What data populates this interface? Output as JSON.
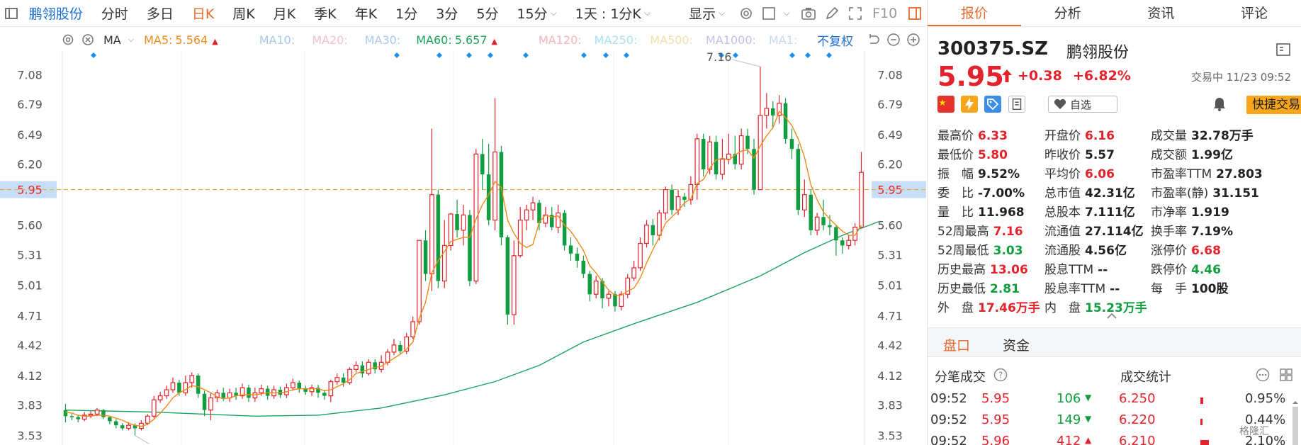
{
  "toolbar": {
    "stock_name": "鹏翎股份",
    "periods": [
      "分时",
      "多日",
      "日K",
      "周K",
      "月K",
      "季K",
      "年K",
      "1分",
      "3分",
      "5分",
      "15分"
    ],
    "active_period": "日K",
    "range_label": "1天 : 1分K",
    "display_label": "显示",
    "f10_label": "F10"
  },
  "ma_bar": {
    "indicator": "MA",
    "ma5": {
      "label": "MA5:",
      "value": "5.564",
      "color": "#ee8a1b"
    },
    "ma10": {
      "label": "MA10:",
      "color": "#a8c7ee"
    },
    "ma20": {
      "label": "MA20:",
      "color": "#f3c0d2"
    },
    "ma30": {
      "label": "MA30:",
      "color": "#a8c7ee"
    },
    "ma60": {
      "label": "MA60:",
      "value": "5.657",
      "color": "#19a35a"
    },
    "ma120": {
      "label": "MA120:",
      "color": "#f3b3bf"
    },
    "ma250": {
      "label": "MA250:",
      "color": "#a9e0f2"
    },
    "ma500": {
      "label": "MA500:",
      "color": "#f2e0a9"
    },
    "ma1000": {
      "label": "MA1000:",
      "color": "#c6bde6"
    },
    "ma1": {
      "label": "MA1:",
      "color": "#c9d8ee"
    },
    "adjust_label": "不复权"
  },
  "chart_data": {
    "type": "candlestick",
    "y_ticks": [
      "7.08",
      "6.79",
      "6.49",
      "6.20",
      "5.95",
      "5.60",
      "5.31",
      "5.01",
      "4.71",
      "4.42",
      "4.12",
      "3.83",
      "3.53"
    ],
    "ylim": [
      3.45,
      7.3
    ],
    "current_price": 5.95,
    "annotations": {
      "high": "7.16",
      "low": "3.53"
    },
    "colors": {
      "up": "#e4222b",
      "down": "#0f9d3f",
      "ma5": "#ee8a1b",
      "ma60": "#19a35a",
      "price_line": "#f2a33a",
      "marker": "#1e8fe8"
    },
    "candles": [
      [
        3.78,
        3.72,
        3.84,
        3.66
      ],
      [
        3.72,
        3.71,
        3.74,
        3.68
      ],
      [
        3.71,
        3.69,
        3.73,
        3.66
      ],
      [
        3.69,
        3.73,
        3.76,
        3.67
      ],
      [
        3.73,
        3.74,
        3.77,
        3.7
      ],
      [
        3.74,
        3.78,
        3.8,
        3.72
      ],
      [
        3.78,
        3.71,
        3.79,
        3.69
      ],
      [
        3.71,
        3.67,
        3.72,
        3.64
      ],
      [
        3.67,
        3.63,
        3.69,
        3.6
      ],
      [
        3.63,
        3.6,
        3.65,
        3.58
      ],
      [
        3.6,
        3.63,
        3.66,
        3.58
      ],
      [
        3.63,
        3.6,
        3.65,
        3.53
      ],
      [
        3.6,
        3.65,
        3.68,
        3.58
      ],
      [
        3.65,
        3.72,
        3.74,
        3.63
      ],
      [
        3.72,
        3.88,
        3.92,
        3.7
      ],
      [
        3.88,
        3.92,
        3.96,
        3.85
      ],
      [
        3.92,
        3.98,
        4.02,
        3.89
      ],
      [
        3.98,
        4.05,
        4.1,
        3.95
      ],
      [
        4.05,
        3.95,
        4.08,
        3.92
      ],
      [
        3.95,
        4.05,
        4.12,
        3.92
      ],
      [
        4.05,
        4.12,
        4.15,
        4.0
      ],
      [
        4.12,
        3.94,
        4.14,
        3.9
      ],
      [
        3.94,
        3.78,
        3.97,
        3.72
      ],
      [
        3.78,
        3.9,
        3.95,
        3.68
      ],
      [
        3.9,
        3.95,
        3.98,
        3.86
      ],
      [
        3.95,
        3.9,
        4.0,
        3.87
      ],
      [
        3.9,
        3.95,
        3.99,
        3.86
      ],
      [
        3.95,
        3.92,
        4.0,
        3.88
      ],
      [
        3.92,
        4.0,
        4.04,
        3.89
      ],
      [
        4.0,
        3.9,
        4.03,
        3.86
      ],
      [
        3.9,
        3.95,
        4.0,
        3.86
      ],
      [
        3.95,
        3.99,
        4.03,
        3.92
      ],
      [
        3.99,
        3.92,
        4.02,
        3.88
      ],
      [
        3.92,
        3.98,
        4.02,
        3.89
      ],
      [
        3.98,
        3.93,
        4.01,
        3.9
      ],
      [
        3.93,
        4.0,
        4.04,
        3.9
      ],
      [
        4.0,
        4.05,
        4.09,
        3.97
      ],
      [
        4.05,
        3.99,
        4.07,
        3.95
      ],
      [
        3.99,
        3.96,
        4.02,
        3.93
      ],
      [
        3.96,
        4.0,
        4.03,
        3.92
      ],
      [
        4.0,
        3.95,
        4.03,
        3.9
      ],
      [
        3.95,
        3.92,
        3.98,
        3.88
      ],
      [
        3.92,
        4.06,
        4.08,
        3.86
      ],
      [
        4.06,
        4.1,
        4.14,
        4.03
      ],
      [
        4.1,
        4.05,
        4.14,
        4.01
      ],
      [
        4.05,
        4.18,
        4.2,
        4.03
      ],
      [
        4.18,
        4.22,
        4.26,
        4.15
      ],
      [
        4.22,
        4.14,
        4.26,
        4.1
      ],
      [
        4.14,
        4.25,
        4.28,
        4.12
      ],
      [
        4.25,
        4.18,
        4.28,
        4.14
      ],
      [
        4.18,
        4.25,
        4.32,
        4.15
      ],
      [
        4.25,
        4.35,
        4.38,
        4.22
      ],
      [
        4.35,
        4.42,
        4.48,
        4.32
      ],
      [
        4.42,
        4.36,
        4.46,
        4.33
      ],
      [
        4.36,
        4.5,
        4.54,
        4.33
      ],
      [
        4.5,
        4.65,
        4.7,
        4.48
      ],
      [
        4.65,
        5.45,
        5.45,
        4.62
      ],
      [
        5.45,
        5.12,
        5.55,
        5.05
      ],
      [
        5.12,
        5.9,
        6.55,
        4.95
      ],
      [
        5.9,
        5.05,
        5.95,
        4.98
      ],
      [
        5.05,
        5.4,
        5.65,
        4.98
      ],
      [
        5.4,
        5.71,
        5.72,
        5.35
      ],
      [
        5.71,
        5.55,
        5.85,
        5.48
      ],
      [
        5.55,
        5.7,
        5.8,
        5.4
      ],
      [
        5.7,
        5.05,
        5.75,
        5.0
      ],
      [
        5.05,
        6.3,
        6.35,
        5.02
      ],
      [
        6.3,
        6.1,
        6.45,
        5.95
      ],
      [
        6.1,
        5.65,
        6.4,
        5.6
      ],
      [
        5.65,
        6.32,
        6.85,
        5.55
      ],
      [
        6.32,
        5.48,
        6.38,
        5.4
      ],
      [
        5.48,
        4.72,
        5.5,
        4.62
      ],
      [
        4.72,
        5.3,
        5.45,
        4.62
      ],
      [
        5.3,
        5.65,
        5.78,
        5.28
      ],
      [
        5.65,
        5.75,
        5.8,
        5.55
      ],
      [
        5.75,
        5.82,
        5.88,
        5.65
      ],
      [
        5.82,
        5.62,
        5.85,
        5.55
      ],
      [
        5.62,
        5.7,
        5.78,
        5.58
      ],
      [
        5.7,
        5.58,
        5.78,
        5.55
      ],
      [
        5.58,
        5.72,
        5.8,
        5.52
      ],
      [
        5.72,
        5.4,
        5.75,
        5.35
      ],
      [
        5.4,
        5.32,
        5.48,
        5.25
      ],
      [
        5.32,
        5.25,
        5.38,
        5.18
      ],
      [
        5.25,
        5.12,
        5.3,
        5.08
      ],
      [
        5.12,
        4.92,
        5.15,
        4.85
      ],
      [
        4.92,
        5.05,
        5.1,
        4.88
      ],
      [
        5.05,
        4.88,
        5.08,
        4.78
      ],
      [
        4.88,
        4.92,
        4.95,
        4.8
      ],
      [
        4.92,
        4.8,
        4.95,
        4.75
      ],
      [
        4.8,
        4.92,
        4.95,
        4.76
      ],
      [
        4.92,
        5.08,
        5.12,
        4.88
      ],
      [
        5.08,
        5.18,
        5.25,
        5.05
      ],
      [
        5.18,
        5.42,
        5.48,
        5.15
      ],
      [
        5.42,
        5.6,
        5.65,
        5.38
      ],
      [
        5.6,
        5.5,
        5.66,
        5.4
      ],
      [
        5.5,
        5.72,
        5.75,
        5.45
      ],
      [
        5.72,
        5.95,
        5.98,
        5.65
      ],
      [
        5.95,
        5.75,
        6.0,
        5.7
      ],
      [
        5.75,
        5.88,
        5.95,
        5.7
      ],
      [
        5.88,
        5.85,
        5.92,
        5.78
      ],
      [
        5.85,
        6.0,
        6.08,
        5.8
      ],
      [
        6.0,
        6.45,
        6.5,
        5.85
      ],
      [
        6.45,
        6.15,
        6.5,
        6.08
      ],
      [
        6.15,
        6.42,
        6.48,
        6.1
      ],
      [
        6.42,
        6.1,
        6.48,
        6.05
      ],
      [
        6.1,
        6.25,
        6.45,
        6.05
      ],
      [
        6.25,
        6.3,
        6.5,
        6.2
      ],
      [
        6.3,
        6.2,
        6.48,
        6.15
      ],
      [
        6.2,
        6.48,
        6.55,
        6.15
      ],
      [
        6.48,
        6.35,
        6.55,
        6.3
      ],
      [
        6.35,
        5.95,
        6.45,
        5.9
      ],
      [
        5.95,
        6.68,
        7.16,
        5.95
      ],
      [
        6.68,
        6.75,
        6.9,
        6.55
      ],
      [
        6.75,
        6.68,
        6.82,
        6.55
      ],
      [
        6.68,
        6.8,
        6.88,
        6.6
      ],
      [
        6.8,
        6.45,
        6.85,
        6.4
      ],
      [
        6.45,
        6.35,
        6.55,
        6.25
      ],
      [
        6.35,
        5.75,
        6.4,
        5.7
      ],
      [
        5.75,
        5.9,
        6.05,
        5.68
      ],
      [
        5.9,
        5.55,
        5.95,
        5.5
      ],
      [
        5.55,
        5.68,
        5.72,
        5.5
      ],
      [
        5.68,
        5.6,
        5.85,
        5.55
      ],
      [
        5.6,
        5.58,
        5.7,
        5.5
      ],
      [
        5.58,
        5.45,
        5.6,
        5.3
      ],
      [
        5.45,
        5.4,
        5.48,
        5.32
      ],
      [
        5.4,
        5.45,
        5.5,
        5.36
      ],
      [
        5.45,
        5.58,
        5.62,
        5.4
      ],
      [
        5.58,
        6.12,
        6.32,
        5.82
      ]
    ],
    "ma5": [
      3.76,
      3.75,
      3.73,
      3.72,
      3.72,
      3.73,
      3.73,
      3.72,
      3.7,
      3.68,
      3.65,
      3.63,
      3.62,
      3.64,
      3.69,
      3.75,
      3.82,
      3.9,
      3.95,
      3.98,
      4.02,
      4.01,
      3.98,
      3.95,
      3.91,
      3.89,
      3.9,
      3.92,
      3.93,
      3.93,
      3.93,
      3.94,
      3.95,
      3.95,
      3.95,
      3.96,
      3.98,
      3.99,
      3.99,
      3.99,
      3.99,
      3.97,
      3.98,
      4.01,
      4.04,
      4.08,
      4.14,
      4.16,
      4.18,
      4.2,
      4.21,
      4.25,
      4.29,
      4.33,
      4.38,
      4.45,
      4.68,
      4.84,
      5.13,
      5.25,
      5.34,
      5.44,
      5.46,
      5.48,
      5.48,
      5.66,
      5.8,
      5.9,
      6.03,
      5.97,
      5.65,
      5.52,
      5.42,
      5.38,
      5.41,
      5.63,
      5.7,
      5.68,
      5.69,
      5.6,
      5.54,
      5.45,
      5.35,
      5.2,
      5.13,
      5.04,
      4.96,
      4.91,
      4.91,
      4.95,
      4.98,
      5.08,
      5.23,
      5.36,
      5.48,
      5.62,
      5.68,
      5.74,
      5.82,
      5.86,
      6.01,
      6.05,
      6.16,
      6.24,
      6.26,
      6.24,
      6.29,
      6.33,
      6.34,
      6.26,
      6.38,
      6.48,
      6.56,
      6.72,
      6.66,
      6.58,
      6.45,
      6.27,
      6.0,
      5.85,
      5.73,
      5.66,
      5.6,
      5.54,
      5.5,
      5.5,
      5.6
    ],
    "ma60_points": [
      [
        0,
        3.78
      ],
      [
        14,
        3.76
      ],
      [
        30,
        3.72
      ],
      [
        40,
        3.73
      ],
      [
        50,
        3.8
      ],
      [
        60,
        3.93
      ],
      [
        68,
        4.06
      ],
      [
        75,
        4.22
      ],
      [
        82,
        4.45
      ],
      [
        90,
        4.63
      ],
      [
        100,
        4.84
      ],
      [
        110,
        5.1
      ],
      [
        117,
        5.33
      ],
      [
        123,
        5.5
      ],
      [
        129,
        5.64
      ]
    ],
    "markers_count": 20
  },
  "quote": {
    "tabs": [
      "报价",
      "分析",
      "资讯",
      "评论"
    ],
    "active_tab": "报价",
    "code": "300375.SZ",
    "name": "鹏翎股份",
    "price": "5.95",
    "change": "+0.38",
    "change_pct": "+6.82%",
    "status": "交易中 11/23 09:52",
    "watch_label": "自选",
    "fast_trade": "快捷交易",
    "fields": [
      {
        "label": "最高价",
        "value": "6.33",
        "color": "red"
      },
      {
        "label": "开盘价",
        "value": "6.16",
        "color": "red"
      },
      {
        "label": "成交量",
        "value": "32.78万手",
        "color": "blk"
      },
      {
        "label": "最低价",
        "value": "5.80",
        "color": "red"
      },
      {
        "label": "昨收价",
        "value": "5.57",
        "color": "blk"
      },
      {
        "label": "成交额",
        "value": "1.99亿",
        "color": "blk"
      },
      {
        "label": "振　幅",
        "value": "9.52%",
        "color": "blk"
      },
      {
        "label": "平均价",
        "value": "6.06",
        "color": "red"
      },
      {
        "label": "市盈率TTM",
        "value": "27.803",
        "color": "blk"
      },
      {
        "label": "委　比",
        "value": "-7.00%",
        "color": "blk"
      },
      {
        "label": "总市值",
        "value": "42.31亿",
        "color": "blk"
      },
      {
        "label": "市盈率(静)",
        "value": "31.151",
        "color": "blk"
      },
      {
        "label": "量　比",
        "value": "11.968",
        "color": "blk"
      },
      {
        "label": "总股本",
        "value": "7.111亿",
        "color": "blk"
      },
      {
        "label": "市净率",
        "value": "1.919",
        "color": "blk"
      },
      {
        "label": "52周最高",
        "value": "7.16",
        "color": "red"
      },
      {
        "label": "流通值",
        "value": "27.114亿",
        "color": "blk"
      },
      {
        "label": "换手率",
        "value": "7.19%",
        "color": "blk"
      },
      {
        "label": "52周最低",
        "value": "3.03",
        "color": "green"
      },
      {
        "label": "流通股",
        "value": "4.56亿",
        "color": "blk"
      },
      {
        "label": "涨停价",
        "value": "6.68",
        "color": "red"
      },
      {
        "label": "历史最高",
        "value": "13.06",
        "color": "red"
      },
      {
        "label": "股息TTM",
        "value": "--",
        "color": "blk"
      },
      {
        "label": "跌停价",
        "value": "4.46",
        "color": "green"
      },
      {
        "label": "历史最低",
        "value": "2.81",
        "color": "green"
      },
      {
        "label": "股息率TTM",
        "value": "--",
        "color": "blk"
      },
      {
        "label": "每　手",
        "value": "100股",
        "color": "blk"
      },
      {
        "label": "外　盘",
        "value": "17.46万手",
        "color": "red"
      },
      {
        "label": "内　盘",
        "value": "15.23万手",
        "color": "green"
      }
    ],
    "subtabs": [
      "盘口",
      "资金"
    ],
    "active_subtab": "盘口",
    "ticks_title": "分笔成交",
    "stats_title": "成交统计",
    "ticks": [
      {
        "time": "09:52",
        "price": "5.95",
        "vol": "106",
        "dir": "down"
      },
      {
        "time": "09:52",
        "price": "5.95",
        "vol": "149",
        "dir": "down"
      },
      {
        "time": "09:52",
        "price": "5.96",
        "vol": "412",
        "dir": "up"
      }
    ],
    "stats": [
      {
        "price": "6.250",
        "pct": "0.95%",
        "share": 0.02
      },
      {
        "price": "6.220",
        "pct": "0.44%",
        "share": 0.01
      },
      {
        "price": "6.210",
        "pct": "2.10%",
        "share": 0.06
      }
    ],
    "watermark": "格隆汇"
  },
  "icons": {
    "toolbar_left": "sidebar-toggle-icon",
    "toolbar_right": [
      "settings-icon",
      "square-icon",
      "camera-icon",
      "pen-icon",
      "expand-icon",
      "panel-icon"
    ],
    "ma_bar": [
      "gear-icon",
      "close-icon"
    ],
    "chart_controls": [
      "undo-icon",
      "minus-icon",
      "plus-icon"
    ]
  }
}
